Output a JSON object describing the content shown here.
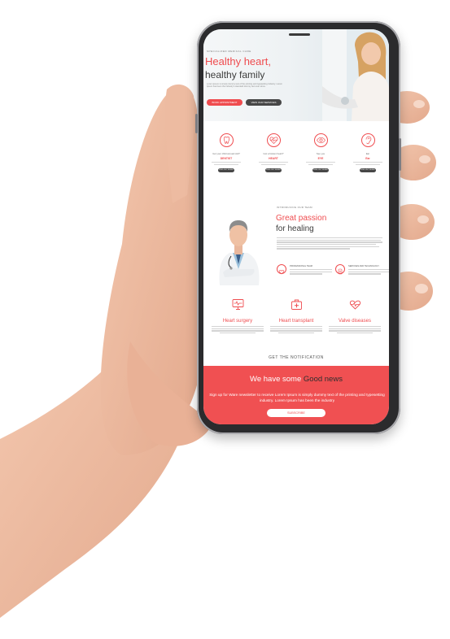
{
  "hero": {
    "eyebrow": "SPECIALIZED MEDICAL CARE",
    "title_line1": "Healthy heart,",
    "title_line2": "healthy family",
    "body": "Lorem ipsum is simply dummy text of the printing and typesetting industry. Lorem Ipsum has been the industry's standard dummy text ever since.",
    "btn_primary": "BOOK APPOINTMENT",
    "btn_secondary": "VIEW OUR SERVICES"
  },
  "services": [
    {
      "question": "Got your child annual visit?",
      "name": "DENTIST",
      "button": "FIND OUT MORE",
      "icon": "tooth-icon"
    },
    {
      "question": "Got a broken heart?",
      "name": "HEART",
      "button": "FIND OUT MORE",
      "icon": "heart-pulse-icon"
    },
    {
      "question": "See you",
      "name": "EYE",
      "button": "FIND OUT MORE",
      "icon": "eye-icon"
    },
    {
      "question": "Ear",
      "name": "Ear",
      "button": "FIND OUT MORE",
      "icon": "ear-icon"
    }
  ],
  "team": {
    "eyebrow": "INTRODUCING OUR TEAM",
    "title_line1": "Great passion",
    "title_line2": "for healing",
    "features": [
      {
        "title": "PROFESSIONAL TEAM",
        "icon": "heart-shield-icon"
      },
      {
        "title": "SERVICES AND TECHNOLOGY",
        "icon": "medical-device-icon"
      }
    ]
  },
  "cards": [
    {
      "title": "Heart surgery",
      "icon": "monitor-heart-icon"
    },
    {
      "title": "Heart transplant",
      "icon": "medical-bag-icon"
    },
    {
      "title": "Valve diseases",
      "icon": "heart-rate-icon"
    }
  ],
  "newsletter": {
    "heading": "GET THE NOTIFICATION",
    "title_prefix": "We have some",
    "title_highlight": "Good news",
    "text": "Sign up for Ware newsletter to receive Lorem Ipsum is simply dummy text of the printing and typesetting industry. Lorem Ipsum has been the industry",
    "subscribe": "SUBSCRIBE"
  },
  "colors": {
    "accent": "#ef4c4f",
    "dark": "#474747",
    "banner": "#f05052"
  }
}
